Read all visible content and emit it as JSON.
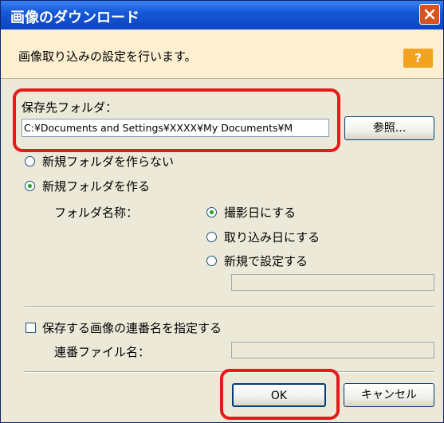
{
  "window": {
    "title": "画像のダウンロード"
  },
  "info": {
    "message": "画像取り込みの設定を行います。",
    "help_label": "?"
  },
  "save_folder": {
    "label": "保存先フォルダ：",
    "path": "C:¥Documents and Settings¥XXXX¥My Documents¥M",
    "browse_label": "参照..."
  },
  "folder_options": {
    "no_new_folder": "新規フォルダを作らない",
    "make_new_folder": "新規フォルダを作る",
    "folder_name_label": "フォルダ名称：",
    "name_shoot_date": "撮影日にする",
    "name_import_date": "取り込み日にする",
    "name_custom": "新規で設定する",
    "custom_value": ""
  },
  "sequence": {
    "checkbox_label": "保存する画像の連番名を指定する",
    "file_name_label": "連番ファイル名：",
    "file_name_value": ""
  },
  "buttons": {
    "ok": "OK",
    "cancel": "キャンセル"
  },
  "colors": {
    "titlebar": "#0b44c2",
    "dialog_bg": "#ece9d8",
    "info_bg": "#fdefd0",
    "highlight": "#e51b1b",
    "help": "#f2a31f"
  }
}
